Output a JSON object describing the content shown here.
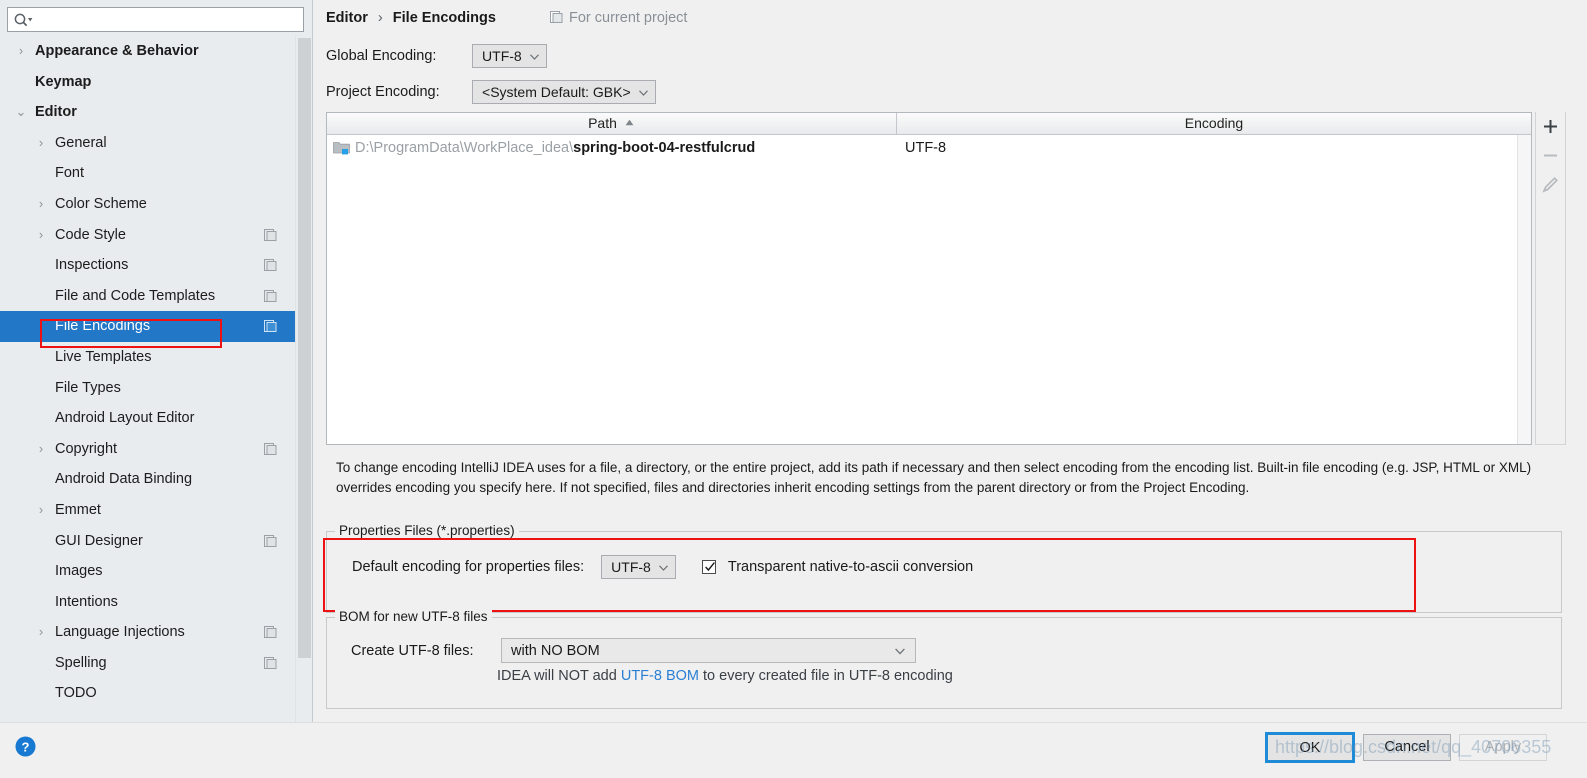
{
  "search": {
    "value": "",
    "placeholder": ""
  },
  "sidebar": {
    "items": [
      {
        "label": "Appearance & Behavior",
        "level": 0,
        "arrow": "›",
        "sheet": false,
        "selected": false
      },
      {
        "label": "Keymap",
        "level": 0,
        "arrow": "",
        "sheet": false,
        "selected": false
      },
      {
        "label": "Editor",
        "level": 0,
        "arrow": "⌄",
        "sheet": false,
        "selected": false
      },
      {
        "label": "General",
        "level": 1,
        "arrow": "›",
        "sheet": false,
        "selected": false
      },
      {
        "label": "Font",
        "level": 1,
        "arrow": "",
        "sheet": false,
        "selected": false
      },
      {
        "label": "Color Scheme",
        "level": 1,
        "arrow": "›",
        "sheet": false,
        "selected": false
      },
      {
        "label": "Code Style",
        "level": 1,
        "arrow": "›",
        "sheet": true,
        "selected": false
      },
      {
        "label": "Inspections",
        "level": 1,
        "arrow": "",
        "sheet": true,
        "selected": false
      },
      {
        "label": "File and Code Templates",
        "level": 1,
        "arrow": "",
        "sheet": true,
        "selected": false
      },
      {
        "label": "File Encodings",
        "level": 1,
        "arrow": "",
        "sheet": true,
        "selected": true
      },
      {
        "label": "Live Templates",
        "level": 1,
        "arrow": "",
        "sheet": false,
        "selected": false
      },
      {
        "label": "File Types",
        "level": 1,
        "arrow": "",
        "sheet": false,
        "selected": false
      },
      {
        "label": "Android Layout Editor",
        "level": 1,
        "arrow": "",
        "sheet": false,
        "selected": false
      },
      {
        "label": "Copyright",
        "level": 1,
        "arrow": "›",
        "sheet": true,
        "selected": false
      },
      {
        "label": "Android Data Binding",
        "level": 1,
        "arrow": "",
        "sheet": false,
        "selected": false
      },
      {
        "label": "Emmet",
        "level": 1,
        "arrow": "›",
        "sheet": false,
        "selected": false
      },
      {
        "label": "GUI Designer",
        "level": 1,
        "arrow": "",
        "sheet": true,
        "selected": false
      },
      {
        "label": "Images",
        "level": 1,
        "arrow": "",
        "sheet": false,
        "selected": false
      },
      {
        "label": "Intentions",
        "level": 1,
        "arrow": "",
        "sheet": false,
        "selected": false
      },
      {
        "label": "Language Injections",
        "level": 1,
        "arrow": "›",
        "sheet": true,
        "selected": false
      },
      {
        "label": "Spelling",
        "level": 1,
        "arrow": "",
        "sheet": true,
        "selected": false
      },
      {
        "label": "TODO",
        "level": 1,
        "arrow": "",
        "sheet": false,
        "selected": false
      }
    ]
  },
  "header": {
    "breadcrumb_parent": "Editor",
    "breadcrumb_sep": "›",
    "breadcrumb_current": "File Encodings",
    "scope_label": "For current project"
  },
  "encodings": {
    "global_label": "Global Encoding:",
    "global_value": "UTF-8",
    "project_label": "Project Encoding:",
    "project_value": "<System Default: GBK>"
  },
  "table": {
    "col_path": "Path",
    "col_encoding": "Encoding",
    "sort_arrow": "▲",
    "rows": [
      {
        "path_prefix": "D:\\ProgramData\\WorkPlace_idea\\",
        "path_name": "spring-boot-04-restfulcrud",
        "encoding": "UTF-8"
      }
    ]
  },
  "toolbar": {
    "add_label": "+",
    "remove_label": "−",
    "edit_label": "edit-pencil-icon"
  },
  "description": "To change encoding IntelliJ IDEA uses for a file, a directory, or the entire project, add its path if necessary and then select encoding from the encoding list. Built-in file encoding (e.g. JSP, HTML or XML) overrides encoding you specify here. If not specified, files and directories inherit encoding settings from the parent directory or from the Project Encoding.",
  "properties_group": {
    "title": "Properties Files (*.properties)",
    "encoding_label": "Default encoding for properties files:",
    "encoding_value": "UTF-8",
    "checkbox_label": "Transparent native-to-ascii conversion",
    "checkbox_checked": true
  },
  "bom_group": {
    "title": "BOM for new UTF-8 files",
    "create_label": "Create UTF-8 files:",
    "create_value": "with NO BOM",
    "note_prefix": "IDEA will NOT add ",
    "note_link": "UTF-8 BOM",
    "note_suffix": " to every created file in UTF-8 encoding"
  },
  "footer": {
    "ok_label": "OK",
    "cancel_label": "Cancel",
    "apply_label": "Apply"
  },
  "watermark": "https://blog.csdn.net/qq_40706355",
  "colors": {
    "selection_blue": "#2277c6",
    "annotation_red": "#ee1111",
    "link_blue": "#2a7fd4",
    "focus_blue": "#1f8ad6",
    "sidebar_bg": "#e8ecef",
    "panel_bg": "#f0f0f0"
  }
}
